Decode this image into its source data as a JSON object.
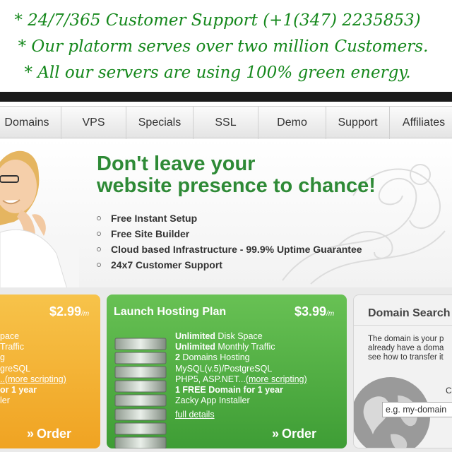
{
  "banner": {
    "line1": "* 24/7/365 Customer Support (+1(347) 2235853)",
    "line2": "* Our platorm serves over two million Customers.",
    "line3": "* All our servers are using 100% green energy."
  },
  "nav": {
    "items": [
      "Domains",
      "VPS",
      "Specials",
      "SSL",
      "Demo",
      "Support",
      "Affiliates"
    ]
  },
  "hero": {
    "title_line1": "Don't leave your",
    "title_line2": "website presence to chance!",
    "features": [
      "Free Instant Setup",
      "Free Site Builder",
      "Cloud based Infrastructure - 99.9% Uptime Guarantee",
      "24x7 Customer Support"
    ]
  },
  "plan_left": {
    "price": "$2.99",
    "per": "/m",
    "specs": [
      "pace",
      "Traffic",
      "g",
      "greSQL",
      "..(more scripting)",
      "or 1 year",
      "ler"
    ],
    "order_label": "Order"
  },
  "plan_launch": {
    "title": "Launch Hosting Plan",
    "price": "$3.99",
    "per": "/m",
    "specs": [
      {
        "strong": "Unlimited",
        "text": " Disk Space"
      },
      {
        "strong": "Unlimited",
        "text": " Monthly Traffic"
      },
      {
        "strong": "2",
        "text": " Domains Hosting"
      },
      {
        "strong": "",
        "text": "MySQL(v.5)/PostgreSQL"
      },
      {
        "strong": "",
        "text": "PHP5, ASP.NET..."
      },
      {
        "strong": "1 FREE Domain for 1 year",
        "text": ""
      },
      {
        "strong": "",
        "text": "Zacky App Installer"
      }
    ],
    "more_scripting": "(more scripting)",
    "details_link": "full details",
    "order_label": "Order"
  },
  "domain_search": {
    "title": "Domain Search",
    "text": [
      "The domain is your p",
      "already have a doma",
      "see how to transfer it"
    ],
    "label_c": "C",
    "input_placeholder": "e.g. my-domain"
  },
  "colors": {
    "banner_text": "#15881c",
    "hero_title": "#2e8a36",
    "orange_plan": "#f0a322",
    "green_plan": "#4caf3e"
  }
}
